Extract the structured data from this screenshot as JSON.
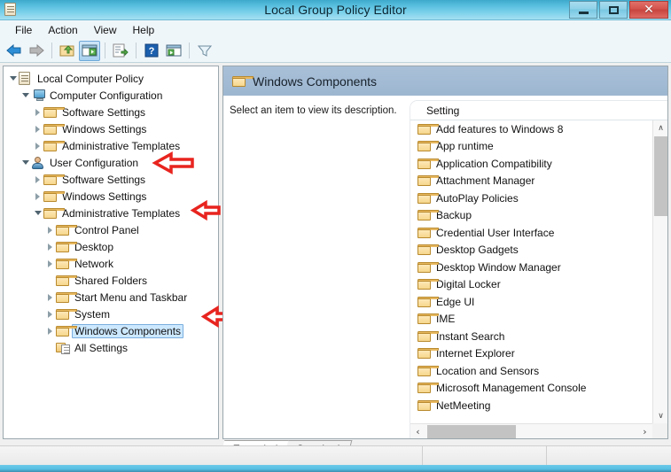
{
  "window": {
    "title": "Local Group Policy Editor",
    "icon": "policy-scroll-icon",
    "controls": {
      "minimize": "—",
      "maximize": "□",
      "close": "✕"
    }
  },
  "menu": {
    "items": [
      "File",
      "Action",
      "View",
      "Help"
    ]
  },
  "toolbar": {
    "buttons": [
      {
        "name": "back-button",
        "icon": "left-arrow-icon"
      },
      {
        "name": "forward-button",
        "icon": "right-arrow-icon"
      },
      {
        "name": "up-one-level-button",
        "icon": "folder-up-icon"
      },
      {
        "name": "show-hide-console-tree-button",
        "icon": "console-tree-icon"
      },
      {
        "name": "export-list-button",
        "icon": "export-list-icon"
      },
      {
        "name": "help-button",
        "icon": "question-mark-icon"
      },
      {
        "name": "properties-button",
        "icon": "properties-window-icon"
      },
      {
        "name": "filter-button",
        "icon": "funnel-icon"
      }
    ]
  },
  "tree": {
    "nodes": [
      {
        "label": "Local Computer Policy",
        "indent": 0,
        "icon": "policy-scroll-icon",
        "expander": "open",
        "selected": false
      },
      {
        "label": "Computer Configuration",
        "indent": 1,
        "icon": "computer-icon",
        "expander": "open",
        "selected": false
      },
      {
        "label": "Software Settings",
        "indent": 2,
        "icon": "folder-icon",
        "expander": "closed",
        "selected": false
      },
      {
        "label": "Windows Settings",
        "indent": 2,
        "icon": "folder-icon",
        "expander": "closed",
        "selected": false
      },
      {
        "label": "Administrative Templates",
        "indent": 2,
        "icon": "folder-icon",
        "expander": "closed",
        "selected": false
      },
      {
        "label": "User Configuration",
        "indent": 1,
        "icon": "user-icon",
        "expander": "open",
        "selected": false
      },
      {
        "label": "Software Settings",
        "indent": 2,
        "icon": "folder-icon",
        "expander": "closed",
        "selected": false
      },
      {
        "label": "Windows Settings",
        "indent": 2,
        "icon": "folder-icon",
        "expander": "closed",
        "selected": false
      },
      {
        "label": "Administrative Templates",
        "indent": 2,
        "icon": "folder-icon",
        "expander": "open",
        "selected": false
      },
      {
        "label": "Control Panel",
        "indent": 3,
        "icon": "folder-icon",
        "expander": "closed",
        "selected": false
      },
      {
        "label": "Desktop",
        "indent": 3,
        "icon": "folder-icon",
        "expander": "closed",
        "selected": false
      },
      {
        "label": "Network",
        "indent": 3,
        "icon": "folder-icon",
        "expander": "closed",
        "selected": false
      },
      {
        "label": "Shared Folders",
        "indent": 3,
        "icon": "folder-icon",
        "expander": "none",
        "selected": false
      },
      {
        "label": "Start Menu and Taskbar",
        "indent": 3,
        "icon": "folder-icon",
        "expander": "closed",
        "selected": false
      },
      {
        "label": "System",
        "indent": 3,
        "icon": "folder-icon",
        "expander": "closed",
        "selected": false
      },
      {
        "label": "Windows Components",
        "indent": 3,
        "icon": "folder-icon",
        "expander": "closed",
        "selected": true
      },
      {
        "label": "All Settings",
        "indent": 3,
        "icon": "all-settings-icon",
        "expander": "none",
        "selected": false
      }
    ]
  },
  "annotations": {
    "color": "#e8241f",
    "arrows": [
      {
        "name": "arrow-user-configuration",
        "points_to": "User Configuration"
      },
      {
        "name": "arrow-administrative-templates",
        "points_to": "Administrative Templates"
      },
      {
        "name": "arrow-windows-components",
        "points_to": "Windows Components"
      }
    ]
  },
  "right_pane": {
    "header_title": "Windows Components",
    "header_icon": "folder-icon",
    "description": "Select an item to view its description.",
    "list_column_header": "Setting",
    "items": [
      "Add features to Windows 8",
      "App runtime",
      "Application Compatibility",
      "Attachment Manager",
      "AutoPlay Policies",
      "Backup",
      "Credential User Interface",
      "Desktop Gadgets",
      "Desktop Window Manager",
      "Digital Locker",
      "Edge UI",
      "IME",
      "Instant Search",
      "Internet Explorer",
      "Location and Sensors",
      "Microsoft Management Console",
      "NetMeeting"
    ],
    "scroll_up_glyph": "∧",
    "scroll_down_glyph": "∨",
    "scroll_left_glyph": "‹",
    "scroll_right_glyph": "›"
  },
  "tabs": {
    "items": [
      {
        "label": "Extended",
        "active": true
      },
      {
        "label": "Standard",
        "active": false
      }
    ]
  },
  "statusbar": {
    "text": ""
  }
}
